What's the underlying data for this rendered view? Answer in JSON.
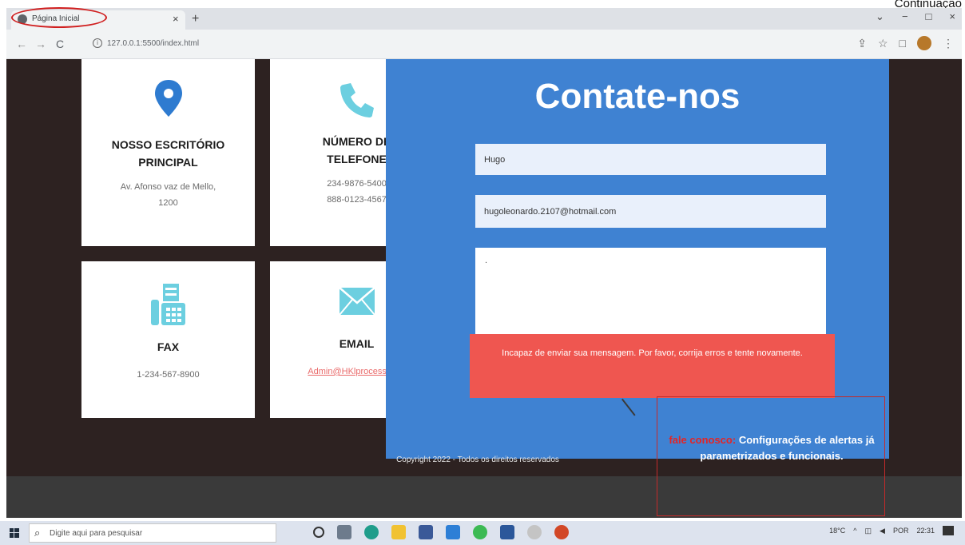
{
  "corner_label": "Continuação",
  "browser": {
    "tab_title": "Página Inicial",
    "tab_close": "×",
    "new_tab": "+",
    "url": "127.0.0.1:5500/index.html",
    "window_controls": [
      "⌄",
      "−",
      "□",
      "×"
    ]
  },
  "cards": [
    {
      "title_line1": "NOSSO ESCRITÓRIO",
      "title_line2": "PRINCIPAL",
      "text_line1": "Av. Afonso vaz de Mello,",
      "text_line2": "1200",
      "icon": "map-pin-icon"
    },
    {
      "title_line1": "NÚMERO DE",
      "title_line2": "TELEFONE",
      "text_line1": "234-9876-5400",
      "text_line2": "888-0123-4567",
      "icon": "phone-icon"
    },
    {
      "title_line1": "FAX",
      "text_line1": "1-234-567-8900",
      "icon": "fax-icon"
    },
    {
      "title_line1": "EMAIL",
      "link": "Admin@HKlprocess.com",
      "icon": "envelope-icon"
    }
  ],
  "contact": {
    "title": "Contate-nos",
    "name_value": "Hugo",
    "email_value": "hugoleonardo.2107@hotmail.com",
    "message_value": "."
  },
  "error_message": "Incapaz de enviar sua mensagem. Por favor, corrija erros e tente novamente.",
  "annotation": {
    "prefix": "fale conosco:",
    "text": "Configurações de alertas já parametrizados e funcionais."
  },
  "footer": {
    "copyright": "Copyright 2022 - Todos os direitos reservados"
  },
  "taskbar": {
    "search_placeholder": "Digite aqui para pesquisar",
    "weather": "18°C",
    "lang": "POR",
    "time": "22:31"
  },
  "colors": {
    "page_bg": "#2d2221",
    "contact_bg": "#3f82d2",
    "error_bg": "#ef5650",
    "icon_blue": "#2e7bd0",
    "icon_teal": "#6ccfe0"
  }
}
